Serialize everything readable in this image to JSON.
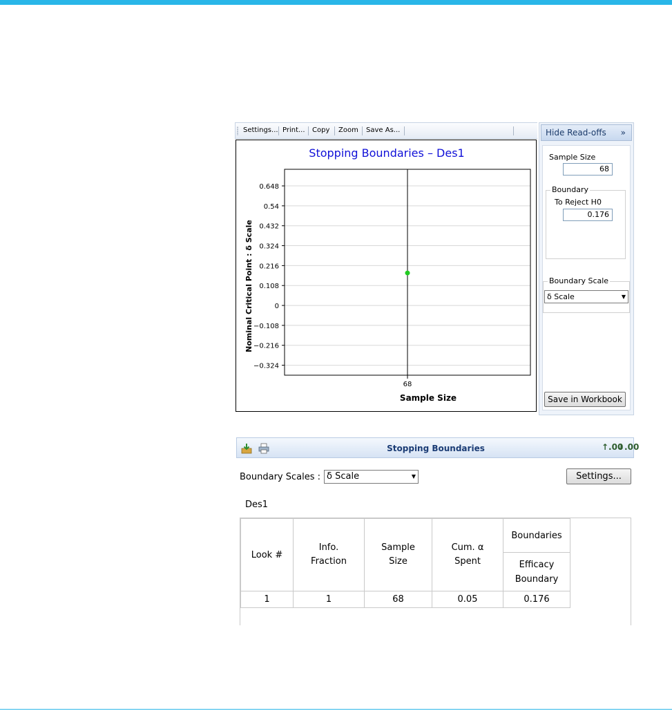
{
  "chart_window": {
    "toolbar": [
      "Settings...",
      "Print...",
      "Copy",
      "Zoom",
      "Save As..."
    ],
    "readoffs": {
      "hide_label": "Hide Read-offs",
      "sample_size_label": "Sample Size",
      "sample_size_value": "68",
      "boundary_group": "Boundary",
      "reject_label": "To Reject H0",
      "reject_value": "0.176",
      "scale_group": "Boundary Scale",
      "scale_value": "δ Scale",
      "save_button": "Save in Workbook"
    }
  },
  "chart_data": {
    "type": "scatter",
    "title": "Stopping Boundaries – Des1",
    "xlabel": "Sample Size",
    "ylabel": "Nominal Critical Point : δ Scale",
    "x_ticks": [
      "68"
    ],
    "y_ticks": [
      "0.648",
      "0.54",
      "0.432",
      "0.324",
      "0.216",
      "0.108",
      "0",
      "−0.108",
      "−0.216",
      "−0.324"
    ],
    "y_tick_values": [
      0.648,
      0.54,
      0.432,
      0.324,
      0.216,
      0.108,
      0,
      -0.108,
      -0.216,
      -0.324
    ],
    "ylim": [
      -0.378,
      0.738
    ],
    "xlim": [
      0,
      136
    ],
    "grid": true,
    "vertical_line_x": 68,
    "points": [
      {
        "x": 68,
        "y": 0.176
      }
    ],
    "point_color": "#22cc22"
  },
  "table_window": {
    "title": "Stopping Boundaries",
    "scales_label": "Boundary Scales :",
    "scales_value": "δ Scale",
    "settings_button": "Settings...",
    "design_label": "Des1",
    "headers": {
      "look": "Look #",
      "info": "Info. Fraction",
      "sample": "Sample Size",
      "alpha": "Cum. α Spent",
      "boundaries": "Boundaries",
      "efficacy": "Efficacy Boundary"
    },
    "rows": [
      {
        "look": "1",
        "info": "1",
        "sample": "68",
        "alpha": "0.05",
        "efficacy": "0.176"
      }
    ]
  }
}
